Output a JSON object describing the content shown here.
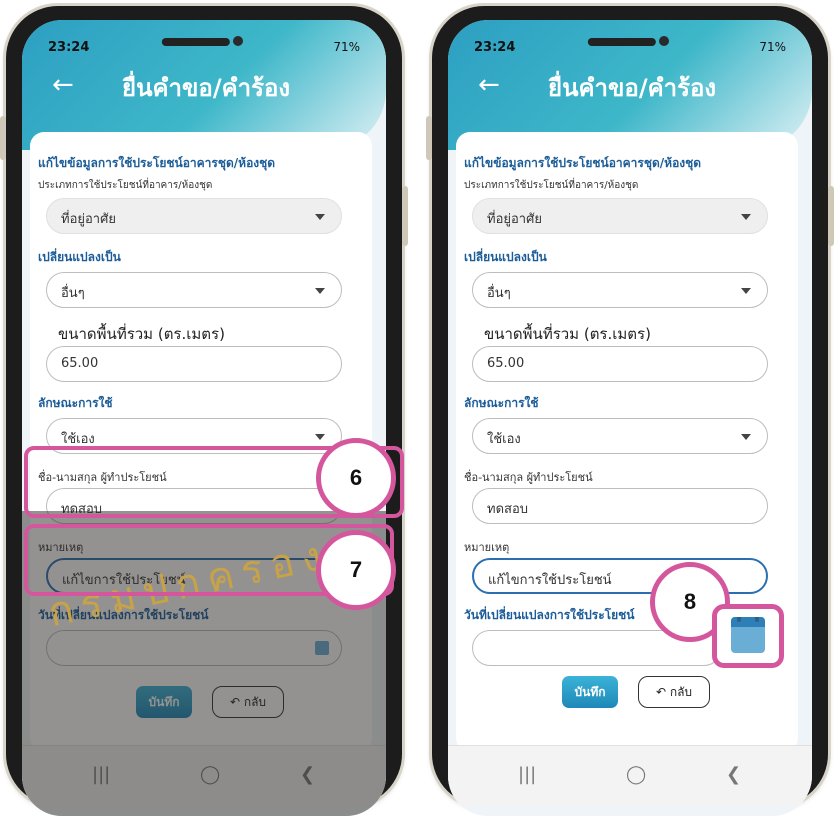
{
  "app": {
    "title": "ยื่นคำขอ/คำร้อง",
    "time": "23:24",
    "status_right": "71%"
  },
  "form": {
    "section_title": "แก้ไขข้อมูลการใช้ประโยชน์อาคารชุด/ห้องชุด",
    "usage_type_label": "ประเภทการใช้ประโยชน์ที่อาคาร/ห้องชุด",
    "usage_type_value": "ที่อยู่อาศัย",
    "change_to_label": "เปลี่ยนแปลงเป็น",
    "change_to_value": "อื่นๆ",
    "area_label": "ขนาดพื้นที่รวม (ตร.เมตร)",
    "area_value": "65.00",
    "usage_nature_label": "ลักษณะการใช้",
    "usage_nature_value": "ใช้เอง",
    "beneficiary_label": "ชื่อ-นามสกุล ผู้ทำประโยชน์",
    "beneficiary_value": "ทดสอบ",
    "remark_label": "หมายเหตุ",
    "remark_value": "แก้ไขการใช้ประโยชน์",
    "change_date_label": "วันที่เปลี่ยนแปลงการใช้ประโยชน์",
    "save_label": "บันทึก",
    "back_label": "กลับ"
  },
  "annotations": {
    "step6": "6",
    "step7": "7",
    "step8": "8",
    "highlight_color": "#d4579e"
  },
  "watermark": {
    "text": "กรมปกครอง"
  },
  "icons": [
    "back-arrow-icon",
    "dropdown-arrow-icon",
    "calendar-icon",
    "undo-icon",
    "recents-icon",
    "home-icon",
    "nav-back-icon"
  ]
}
